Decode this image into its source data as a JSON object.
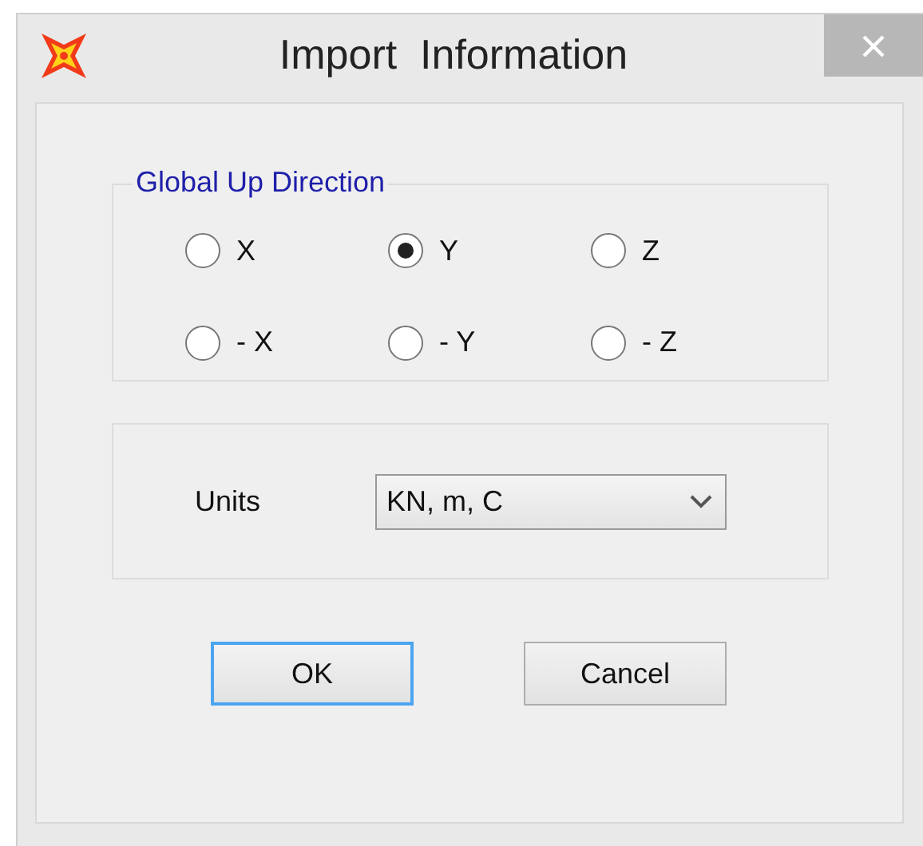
{
  "window": {
    "title": "Import  Information"
  },
  "direction": {
    "label": "Global Up Direction",
    "options": [
      {
        "label": "X",
        "selected": false
      },
      {
        "label": "Y",
        "selected": true
      },
      {
        "label": "Z",
        "selected": false
      },
      {
        "label": "- X",
        "selected": false
      },
      {
        "label": "- Y",
        "selected": false
      },
      {
        "label": "- Z",
        "selected": false
      }
    ]
  },
  "units": {
    "label": "Units",
    "value": "KN, m, C"
  },
  "buttons": [
    {
      "label": "OK",
      "focused": true
    },
    {
      "label": "Cancel",
      "focused": false
    }
  ]
}
